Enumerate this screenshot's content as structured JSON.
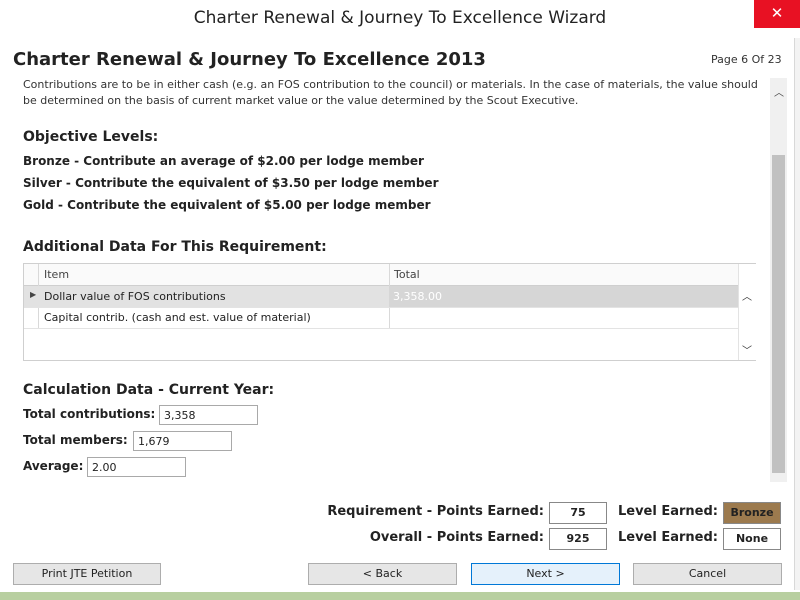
{
  "window": {
    "title": "Charter Renewal & Journey To Excellence Wizard",
    "close_glyph": "✕"
  },
  "header": {
    "title": "Charter Renewal & Journey To Excellence 2013",
    "page_indicator": "Page 6 Of 23"
  },
  "intro_text": "Contributions are to be in either cash (e.g. an FOS contribution to the council) or materials. In the case of materials, the value should be determined on the basis of current market value or the value determined by the Scout Executive.",
  "objective_levels": {
    "heading": "Objective Levels:",
    "bronze": "Bronze - Contribute an average of $2.00 per lodge member",
    "silver": "Silver - Contribute the equivalent of $3.50 per lodge member",
    "gold": "Gold - Contribute the equivalent of $5.00 per lodge member"
  },
  "additional_data": {
    "heading": "Additional Data For This Requirement:",
    "columns": [
      "Item",
      "Total"
    ],
    "rows": [
      {
        "item": "Dollar value of FOS contributions",
        "total": "3,358.00"
      },
      {
        "item": "Capital contrib. (cash and est. value of material)",
        "total": ""
      }
    ]
  },
  "calculation": {
    "heading": "Calculation Data - Current Year:",
    "total_contributions_label": "Total contributions:",
    "total_contributions_value": "3,358",
    "total_members_label": "Total members:",
    "total_members_value": "1,679",
    "average_label": "Average:",
    "average_value": "2.00"
  },
  "points": {
    "requirement_label": "Requirement - Points Earned:",
    "requirement_points": "75",
    "requirement_level_label": "Level Earned:",
    "requirement_level": "Bronze",
    "overall_label": "Overall - Points Earned:",
    "overall_points": "925",
    "overall_level_label": "Level Earned:",
    "overall_level": "None",
    "bronze_color": "#9c7a4e"
  },
  "buttons": {
    "print": "Print JTE Petition",
    "back": "< Back",
    "next": "Next >",
    "cancel": "Cancel"
  }
}
